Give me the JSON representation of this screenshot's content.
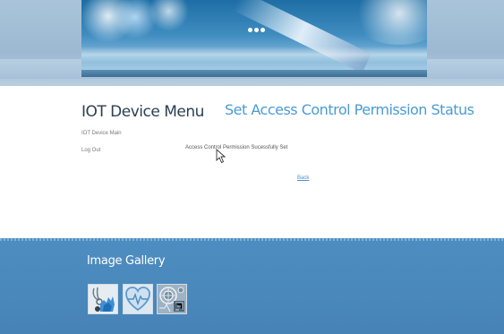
{
  "sidebar": {
    "title": "IOT Device Menu",
    "items": [
      {
        "label": "IOT Device Main"
      },
      {
        "label": "Log Out"
      }
    ]
  },
  "main": {
    "title": "Set Access Control Permission Status",
    "message": "Access Control Permission Sucessfully Set",
    "back_label": "Back"
  },
  "footer": {
    "gallery_title": "Image Gallery",
    "thumbnails": [
      {
        "icon": "stethoscope-hand-icon"
      },
      {
        "icon": "heart-pulse-icon"
      },
      {
        "icon": "medical-circuit-icon"
      }
    ]
  },
  "colors": {
    "accent": "#4a9bd3",
    "footer": "#4a88bc",
    "header_band": "#a9c4da"
  }
}
